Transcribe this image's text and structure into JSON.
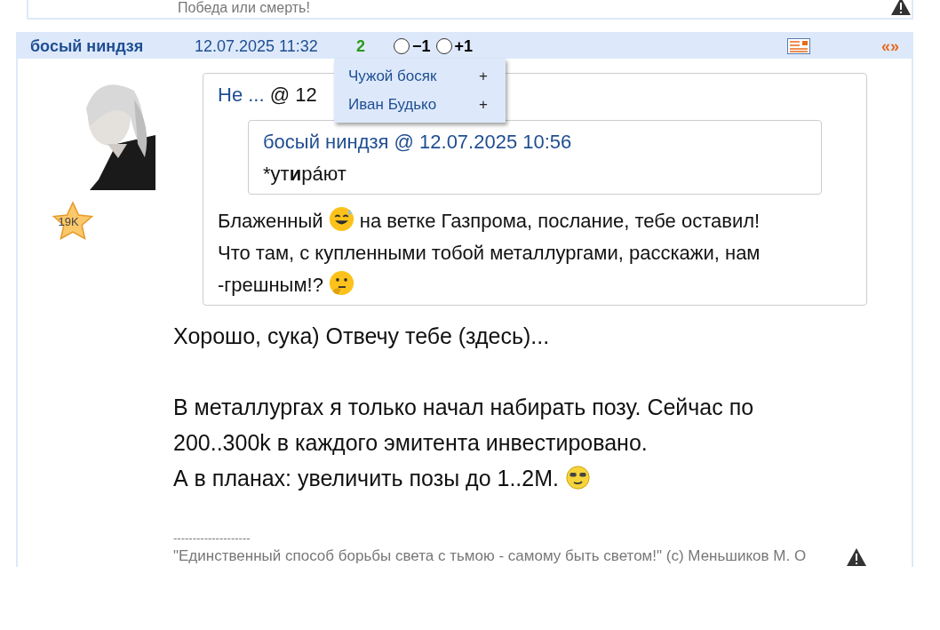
{
  "previous_post": {
    "text": "Победа или смерть!"
  },
  "post": {
    "author": "босый ниндзя",
    "date": "12.07.2025 11:32",
    "rating": "2",
    "votes": [
      {
        "label": "−1",
        "selected": false
      },
      {
        "label": "+1",
        "selected": false
      }
    ],
    "quote_link": "«»",
    "voters_menu": [
      {
        "name": "Чужой босяк",
        "action": "+"
      },
      {
        "name": "Иван Будько",
        "action": "+"
      }
    ],
    "badge": "19K",
    "quote": {
      "author": "Не ...",
      "at": "@ 12",
      "nested": {
        "author": "босый ниндзя",
        "at": "@ 12.07.2025 10:56",
        "text": "*ут**и**рáют"
      },
      "paragraphs": [
        [
          {
            "kind": "text",
            "text": "Блаженный "
          },
          {
            "kind": "sweat"
          },
          {
            "kind": "text",
            "text": " на ветке Газпрома, послание, тебе оставил!"
          }
        ],
        [
          {
            "kind": "text",
            "text": "Что там, с купленными тобой металлургами, расскажи, нам -грешным!? "
          },
          {
            "kind": "thinking"
          }
        ]
      ]
    },
    "body": [
      [
        {
          "kind": "text",
          "text": "Хорошо, сука) Отвечу тебе (здесь)..."
        }
      ],
      [
        {
          "kind": "text",
          "text": "В металлургах я только начал набирать позу. Сейчас по 200..300k в каждого эмитента инвестировано."
        }
      ],
      [
        {
          "kind": "text",
          "text": "А в планах: увеличить позы до 1..2М. "
        },
        {
          "kind": "cool"
        }
      ]
    ],
    "signature_rule": "--------------------",
    "signature": "\"Единственный способ борьбы света с тьмою - самому быть светом!\" (с) Меньшиков М. О"
  }
}
